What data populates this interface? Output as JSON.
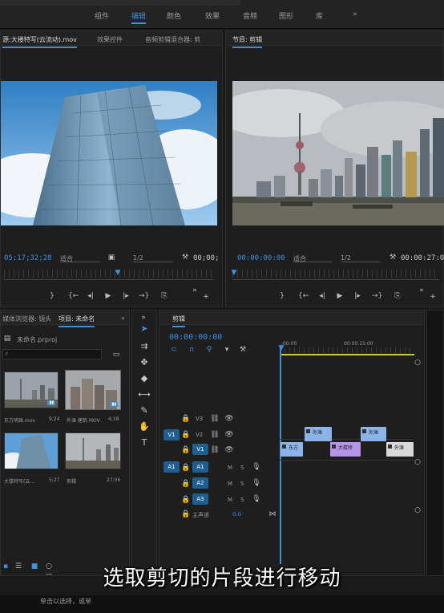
{
  "workspace_tabs": [
    "组件",
    "编辑",
    "颜色",
    "效果",
    "音频",
    "图形",
    "库"
  ],
  "workspace_active": "编辑",
  "more_glyph": "»",
  "source_monitor": {
    "tabs": [
      "源:大楼特写(云流动).mov",
      "效果控件",
      "音频剪辑混合器: 剪"
    ],
    "timecode": "05;17;32;28",
    "fit_label": "适合",
    "zoom_ratio": "1/2",
    "end_timecode": "00;00;"
  },
  "program_monitor": {
    "tab": "节目: 剪辑",
    "timecode": "00:00:00:00",
    "fit_label": "适合",
    "zoom_ratio": "1/2",
    "duration": "00:00:27:06"
  },
  "project_panel": {
    "tabs": [
      "媒体浏览器: 镜头",
      "项目: 未命名"
    ],
    "file_name": "未命名.prproj",
    "items": [
      {
        "label": "东方明珠.mov",
        "duration": "9;24"
      },
      {
        "label": "外滩 建筑.MOV",
        "duration": "4;18"
      },
      {
        "label": "大楼特写(云...",
        "duration": "5;27"
      },
      {
        "label": "剪辑",
        "duration": "27;06"
      }
    ]
  },
  "timeline": {
    "tab": "剪辑",
    "timecode": "00:00:00:00",
    "ruler": [
      ":00:00",
      "00:00:15:00"
    ],
    "video_tracks": [
      "V3",
      "V2",
      "V1"
    ],
    "audio_tracks": [
      "A1",
      "A2",
      "A3"
    ],
    "source_v": "V1",
    "source_a": "A1",
    "master_label": "主声道",
    "master_value": "0.0",
    "m_label": "M",
    "s_label": "S",
    "clips": [
      {
        "track": "V1",
        "label": "东方",
        "color": "#8ab4e8"
      },
      {
        "track": "V2",
        "label": "外滩",
        "color": "#8ab4e8"
      },
      {
        "track": "V1",
        "label": "大楼特",
        "color": "#b894e8"
      },
      {
        "track": "V2",
        "label": "外滩",
        "color": "#8ab4e8"
      },
      {
        "track": "V1",
        "label": "外滩",
        "color": "#d8d8d8"
      }
    ]
  },
  "status_text": "单击以选择，或单",
  "subtitle": "选取剪切的片段进行移动",
  "colors": {
    "accent": "#3f8fe0",
    "violet_clip": "#b894e8",
    "blue_clip": "#8ab4e8"
  }
}
